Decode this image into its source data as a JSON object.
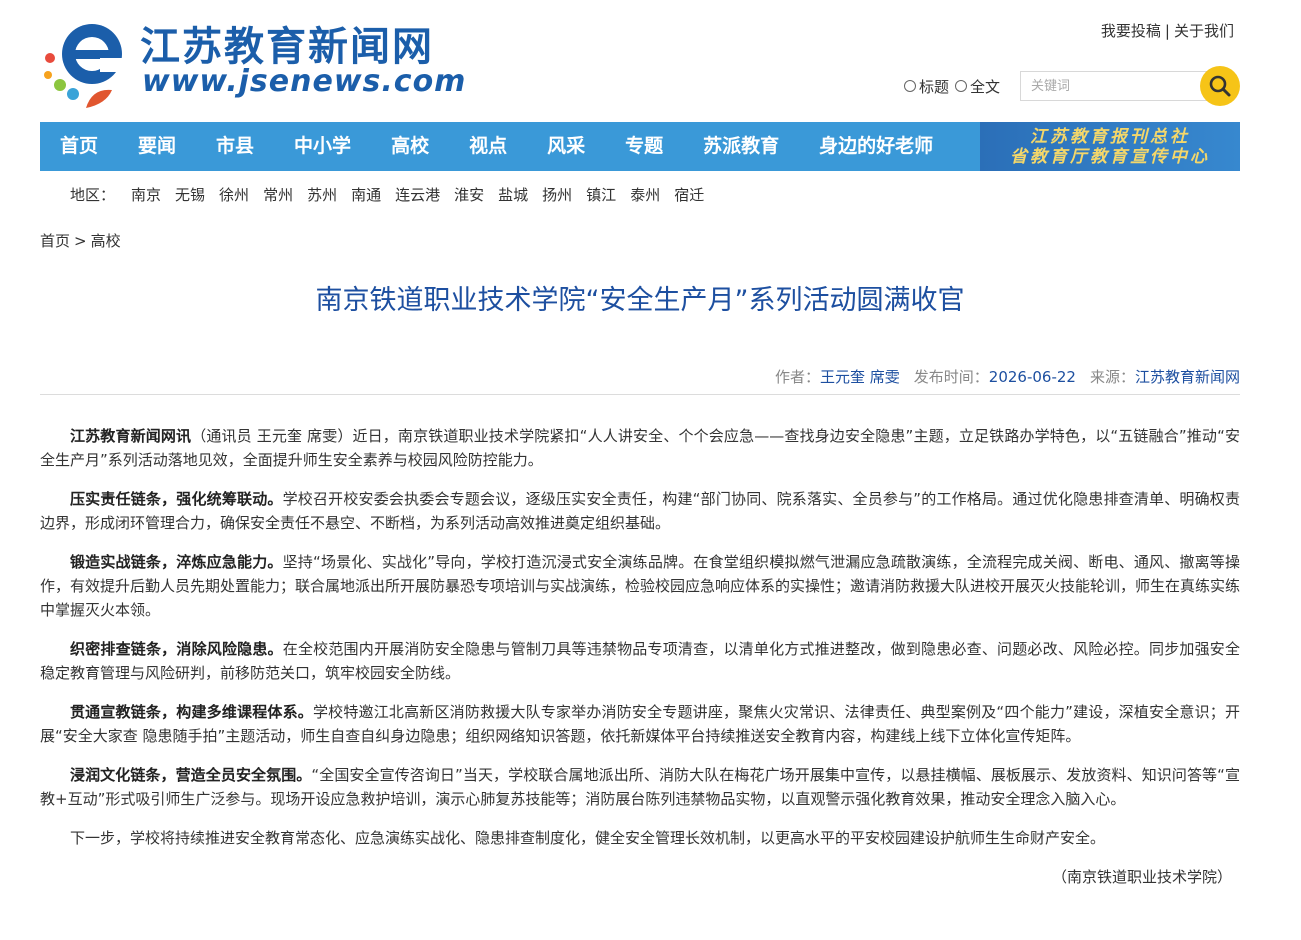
{
  "site": {
    "title": "江苏教育新闻网",
    "url": "www.jsenews.com",
    "logo_letter": "e"
  },
  "top_links": [
    "我要投稿",
    "关于我们"
  ],
  "search": {
    "options": [
      "标题",
      "全文"
    ],
    "placeholder": "关键词",
    "icon": "search-icon",
    "button_color": "#f6c417"
  },
  "nav": {
    "items": [
      "首页",
      "要闻",
      "市县",
      "中小学",
      "高校",
      "视点",
      "风采",
      "专题",
      "苏派教育",
      "身边的好老师"
    ],
    "banner_lines": [
      "江苏教育报刊总社",
      "省教育厅教育宣传中心"
    ],
    "color": "#3a99d8"
  },
  "region": {
    "label": "地区：",
    "items": [
      "南京",
      "无锡",
      "徐州",
      "常州",
      "苏州",
      "南通",
      "连云港",
      "淮安",
      "盐城",
      "扬州",
      "镇江",
      "泰州",
      "宿迁"
    ]
  },
  "breadcrumb": [
    "首页",
    "高校"
  ],
  "breadcrumb_sep": ">",
  "article": {
    "title": "南京铁道职业技术学院“安全生产月”系列活动圆满收官",
    "meta": {
      "author_label": "作者：",
      "author": "王元奎 席雯",
      "date_label": "发布时间：",
      "date": "2026-06-22",
      "source_label": "来源：",
      "source": "江苏教育新闻网"
    },
    "paragraphs": [
      {
        "lead": "江苏教育新闻网讯",
        "text": "（通讯员 王元奎 席雯）近日，南京铁道职业技术学院紧扣“人人讲安全、个个会应急——查找身边安全隐患”主题，立足铁路办学特色，以“五链融合”推动“安全生产月”系列活动落地见效，全面提升师生安全素养与校园风险防控能力。"
      },
      {
        "lead": "压实责任链条，强化统筹联动。",
        "text": "学校召开校安委会执委会专题会议，逐级压实安全责任，构建“部门协同、院系落实、全员参与”的工作格局。通过优化隐患排查清单、明确权责边界，形成闭环管理合力，确保安全责任不悬空、不断档，为系列活动高效推进奠定组织基础。"
      },
      {
        "lead": "锻造实战链条，淬炼应急能力。",
        "text": "坚持“场景化、实战化”导向，学校打造沉浸式安全演练品牌。在食堂组织模拟燃气泄漏应急疏散演练，全流程完成关阀、断电、通风、撤离等操作，有效提升后勤人员先期处置能力；联合属地派出所开展防暴恐专项培训与实战演练，检验校园应急响应体系的实操性；邀请消防救援大队进校开展灭火技能轮训，师生在真练实练中掌握灭火本领。"
      },
      {
        "lead": "织密排查链条，消除风险隐患。",
        "text": "在全校范围内开展消防安全隐患与管制刀具等违禁物品专项清查，以清单化方式推进整改，做到隐患必查、问题必改、风险必控。同步加强安全稳定教育管理与风险研判，前移防范关口，筑牢校园安全防线。"
      },
      {
        "lead": "贯通宣教链条，构建多维课程体系。",
        "text": "学校特邀江北高新区消防救援大队专家举办消防安全专题讲座，聚焦火灾常识、法律责任、典型案例及“四个能力”建设，深植安全意识；开展“安全大家查 隐患随手拍”主题活动，师生自查自纠身边隐患；组织网络知识答题，依托新媒体平台持续推送安全教育内容，构建线上线下立体化宣传矩阵。"
      },
      {
        "lead": "浸润文化链条，营造全员安全氛围。",
        "text": "“全国安全宣传咨询日”当天，学校联合属地派出所、消防大队在梅花广场开展集中宣传，以悬挂横幅、展板展示、发放资料、知识问答等“宣教+互动”形式吸引师生广泛参与。现场开设应急救护培训，演示心肺复苏技能等；消防展台陈列违禁物品实物，以直观警示强化教育效果，推动安全理念入脑入心。"
      },
      {
        "lead": "",
        "text": "下一步，学校将持续推进安全教育常态化、应急演练实战化、隐患排查制度化，健全安全管理长效机制，以更高水平的平安校园建设护航师生生命财产安全。"
      }
    ],
    "source_note": "（南京铁道职业技术学院）"
  }
}
